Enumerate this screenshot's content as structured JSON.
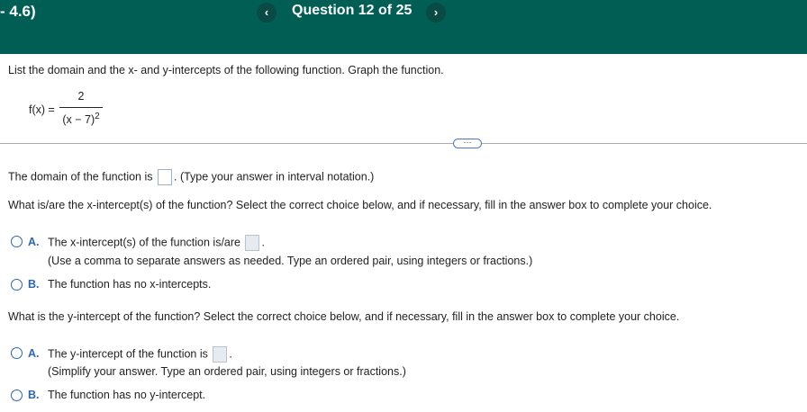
{
  "header": {
    "section": "- 4.6)",
    "question_title": "Question 12 of 25",
    "prev_glyph": "‹",
    "next_glyph": "›"
  },
  "instructions": "List the domain and the x- and y-intercepts of the following function. Graph the function.",
  "function": {
    "label": "f(x) =",
    "numerator": "2",
    "denominator_base": "(x − 7)",
    "denominator_exponent": "2"
  },
  "more_button": "···",
  "domain": {
    "prefix": "The domain of the function is",
    "suffix": ". (Type your answer in interval notation.)"
  },
  "x_intercepts": {
    "question": "What is/are the x-intercept(s) of the function? Select the correct choice below, and if necessary, fill in the answer box to complete your choice.",
    "option_a_letter": "A.",
    "option_a_text": "The x-intercept(s) of the function is/are",
    "option_a_hint": "(Use a comma to separate answers as needed. Type an ordered pair, using integers or fractions.)",
    "option_b_letter": "B.",
    "option_b_text": "The function has no x-intercepts."
  },
  "y_intercept": {
    "question": "What is the y-intercept of the function? Select the correct choice below, and if necessary, fill in the answer box to complete your choice.",
    "option_a_letter": "A.",
    "option_a_text": "The y-intercept of the function is",
    "option_a_hint": "(Simplify your answer. Type an ordered pair, using integers or fractions.)",
    "option_b_letter": "B.",
    "option_b_text": "The function has no y-intercept."
  },
  "colors": {
    "header_bg": "#005e55",
    "accent_blue": "#2a66b8"
  }
}
